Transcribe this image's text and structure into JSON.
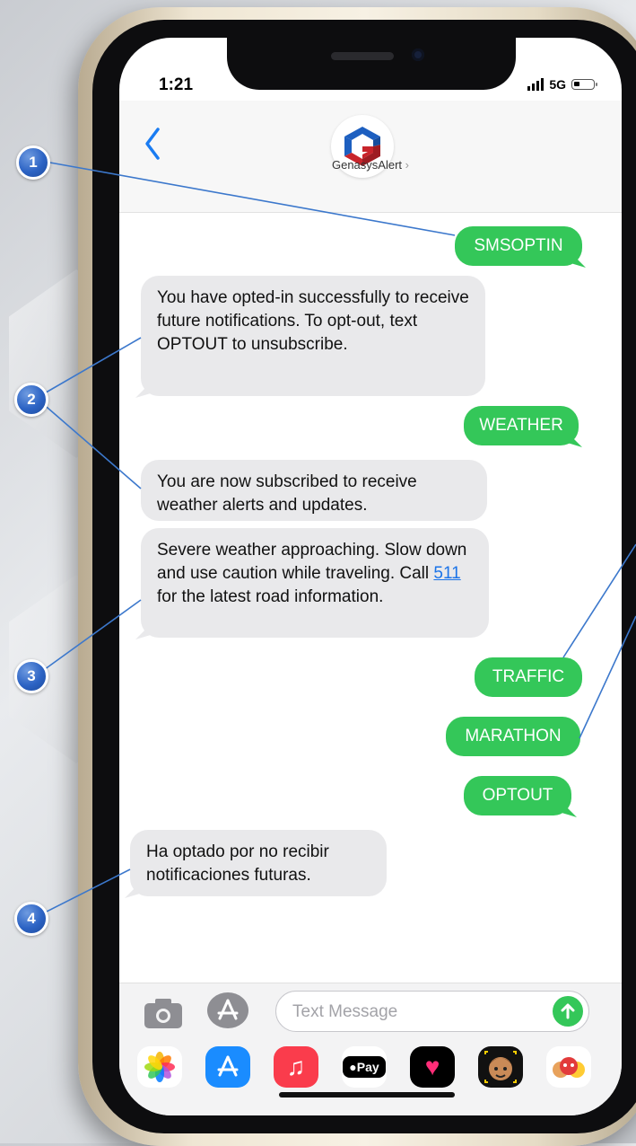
{
  "status": {
    "time": "1:21",
    "network": "5G"
  },
  "contact": {
    "name": "GenasysAlert",
    "chevron": "›"
  },
  "messages": [
    {
      "dir": "out",
      "text": "SMSOPTIN"
    },
    {
      "dir": "in",
      "text": "You have opted-in successfully to receive future notifications. To opt-out, text OPTOUT to unsubscribe."
    },
    {
      "dir": "out",
      "text": "WEATHER"
    },
    {
      "dir": "in",
      "text": "You are now subscribed to receive weather alerts and updates."
    },
    {
      "dir": "in",
      "text_before": "Severe weather approaching. Slow down and use caution while traveling. Call ",
      "link": "511",
      "text_after": " for the latest road information."
    },
    {
      "dir": "out",
      "text": "TRAFFIC"
    },
    {
      "dir": "out",
      "text": "MARATHON"
    },
    {
      "dir": "out",
      "text": "OPTOUT"
    },
    {
      "dir": "in",
      "text": "Ha optado por no recibir notificaciones futuras."
    }
  ],
  "composer": {
    "placeholder": "Text Message",
    "icons": {
      "camera": "camera-icon",
      "apps": "app-store-icon",
      "send": "send-arrow-icon"
    }
  },
  "app_drawer": [
    {
      "name": "photos-app-icon"
    },
    {
      "name": "app-store-icon"
    },
    {
      "name": "music-app-icon"
    },
    {
      "name": "apple-pay-icon",
      "label": "Pay"
    },
    {
      "name": "digital-touch-icon"
    },
    {
      "name": "memoji-icon"
    },
    {
      "name": "animoji-icon"
    }
  ],
  "callouts": [
    "1",
    "2",
    "3",
    "4"
  ],
  "colors": {
    "outgoing": "#34c759",
    "incoming": "#e9e9eb",
    "link": "#1a73e8",
    "callout": "#2c63c4"
  }
}
